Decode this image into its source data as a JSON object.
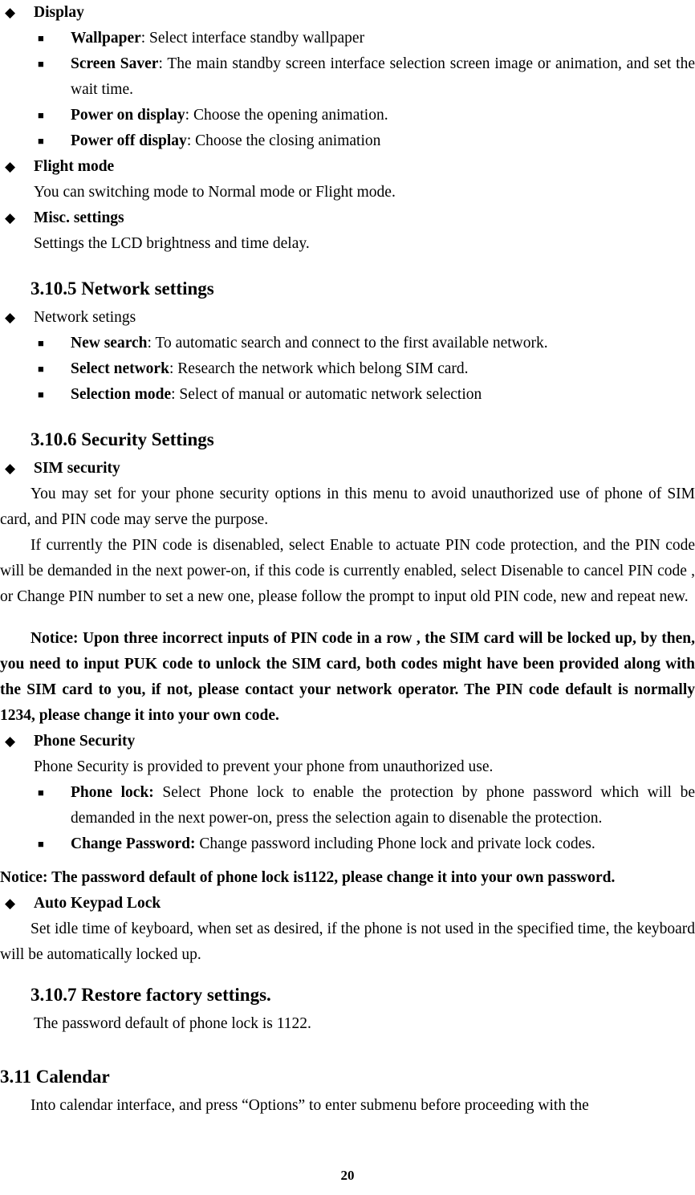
{
  "document": {
    "page_number": "20",
    "sections": [
      {
        "type": "bullet1",
        "bullet": "◆",
        "label": "Display",
        "bold": true
      },
      {
        "type": "bullet2",
        "bullet": "■",
        "term": "Wallpaper",
        "rest": ": Select interface standby wallpaper"
      },
      {
        "type": "bullet2",
        "bullet": "■",
        "term": "Screen Saver",
        "rest": ": The main standby screen interface selection screen image or animation, and set the wait time."
      },
      {
        "type": "bullet2",
        "bullet": "■",
        "term": "Power on display",
        "rest": ": Choose the opening animation."
      },
      {
        "type": "bullet2",
        "bullet": "■",
        "term": "Power off display",
        "rest": ": Choose the closing animation"
      },
      {
        "type": "bullet1",
        "bullet": "◆",
        "label": "Flight mode",
        "bold": true
      },
      {
        "type": "body",
        "text": "You can switching mode to Normal mode or Flight mode."
      },
      {
        "type": "bullet1",
        "bullet": "◆",
        "label": "Misc. settings",
        "bold": true
      },
      {
        "type": "body",
        "text": "Settings the LCD brightness and time delay."
      },
      {
        "type": "heading-sub",
        "text": "3.10.5 Network settings"
      },
      {
        "type": "bullet1",
        "bullet": "◆",
        "label": "Network setings",
        "bold": false
      },
      {
        "type": "bullet2",
        "bullet": "■",
        "term": "New search",
        "rest": ": To automatic search and connect to the first available network."
      },
      {
        "type": "bullet2",
        "bullet": "■",
        "term": "Select network",
        "rest": ": Research the network which belong SIM card."
      },
      {
        "type": "bullet2",
        "bullet": "■",
        "term": "Selection mode",
        "rest": ": Select of manual or automatic network selection"
      },
      {
        "type": "heading-sub",
        "text": "3.10.6 Security Settings"
      },
      {
        "type": "bullet1",
        "bullet": "◆",
        "label": "SIM security",
        "bold": true
      },
      {
        "type": "para",
        "text": "You may set for your phone security options in this menu to avoid unauthorized use of phone of SIM card, and PIN code may serve the purpose."
      },
      {
        "type": "para",
        "text": "If currently the PIN code is disenabled, select Enable to actuate PIN code protection, and the PIN code will be demanded in the next power-on, if this code is currently enabled, select Disenable to cancel PIN code , or Change PIN number to set a new one, please follow the prompt to input old PIN code, new and repeat new."
      },
      {
        "type": "para-bold",
        "text": "Notice: Upon three incorrect inputs of PIN code in a row , the SIM card will be locked up, by then, you need to input PUK code to unlock the SIM card, both codes might have been provided along with the SIM card to you, if not, please contact your network operator. The PIN code default is normally 1234, please change it into your own code."
      },
      {
        "type": "bullet1",
        "bullet": "◆",
        "label": "Phone Security",
        "bold": true
      },
      {
        "type": "body",
        "text": "Phone Security is provided to prevent your phone from unauthorized use."
      },
      {
        "type": "bullet2",
        "bullet": "■",
        "term": "Phone lock:",
        "rest": " Select Phone lock to enable the protection by phone password which will be demanded in the next power-on, press the selection again to disenable the protection."
      },
      {
        "type": "bullet2",
        "bullet": "■",
        "term": "Change Password:",
        "rest": " Change password including Phone lock and private lock codes."
      },
      {
        "type": "notice",
        "text": "Notice: The password default of phone lock is1122, please change it into your own password."
      },
      {
        "type": "bullet1",
        "bullet": "◆",
        "label": "Auto Keypad Lock",
        "bold": true
      },
      {
        "type": "para",
        "text": "Set idle time of keyboard, when set as desired, if the phone is not used in the specified time, the keyboard will be automatically locked up."
      },
      {
        "type": "heading-sub",
        "text": "3.10.7 Restore factory settings."
      },
      {
        "type": "body",
        "text": "The password default of phone lock is 1122."
      },
      {
        "type": "heading-main",
        "text": "3.11 Calendar"
      },
      {
        "type": "para",
        "text": "Into calendar interface, and press “Options” to enter submenu before proceeding with the"
      }
    ]
  }
}
